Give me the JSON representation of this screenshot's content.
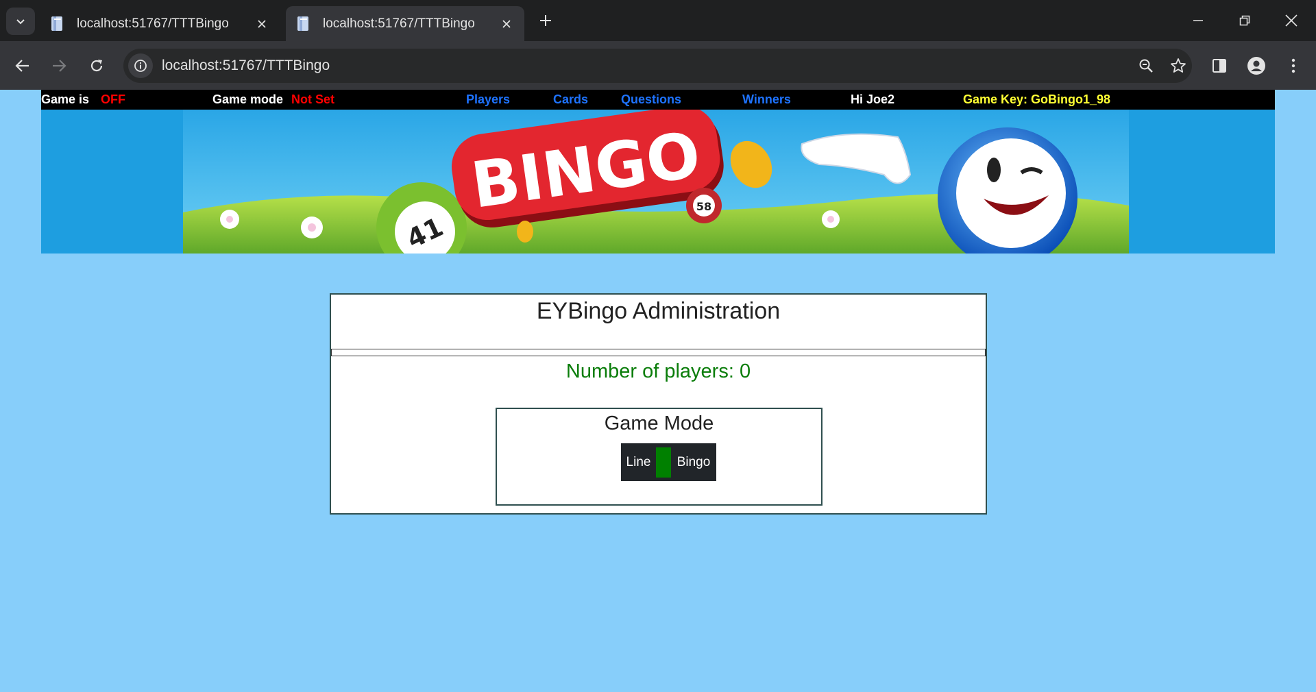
{
  "browser": {
    "tabs": [
      {
        "title": "localhost:51767/TTTBingo",
        "active": false
      },
      {
        "title": "localhost:51767/TTTBingo",
        "active": true
      }
    ],
    "url": "localhost:51767/TTTBingo"
  },
  "topbar": {
    "game_is_label": "Game is",
    "game_status": "OFF",
    "game_mode_label": "Game mode",
    "game_mode_value": "Not Set",
    "nav": {
      "players": "Players",
      "cards": "Cards",
      "questions": "Questions",
      "winners": "Winners"
    },
    "greeting": "Hi Joe2",
    "game_key": "Game Key: GoBingo1_98"
  },
  "banner": {
    "logo_text": "BINGO",
    "ball_numbers": [
      "41",
      "58"
    ]
  },
  "admin": {
    "title": "EYBingo Administration",
    "players_count": "Number of players: 0"
  },
  "game_mode": {
    "title": "Game Mode",
    "option_line": "Line",
    "option_bingo": "Bingo"
  },
  "colors": {
    "page_background": "#87cefa",
    "status_off": "#ff0000",
    "nav_link": "#1e73ff",
    "game_key": "#ffff33",
    "players_count": "#0a7d0a",
    "toggle_knob": "#008000"
  }
}
